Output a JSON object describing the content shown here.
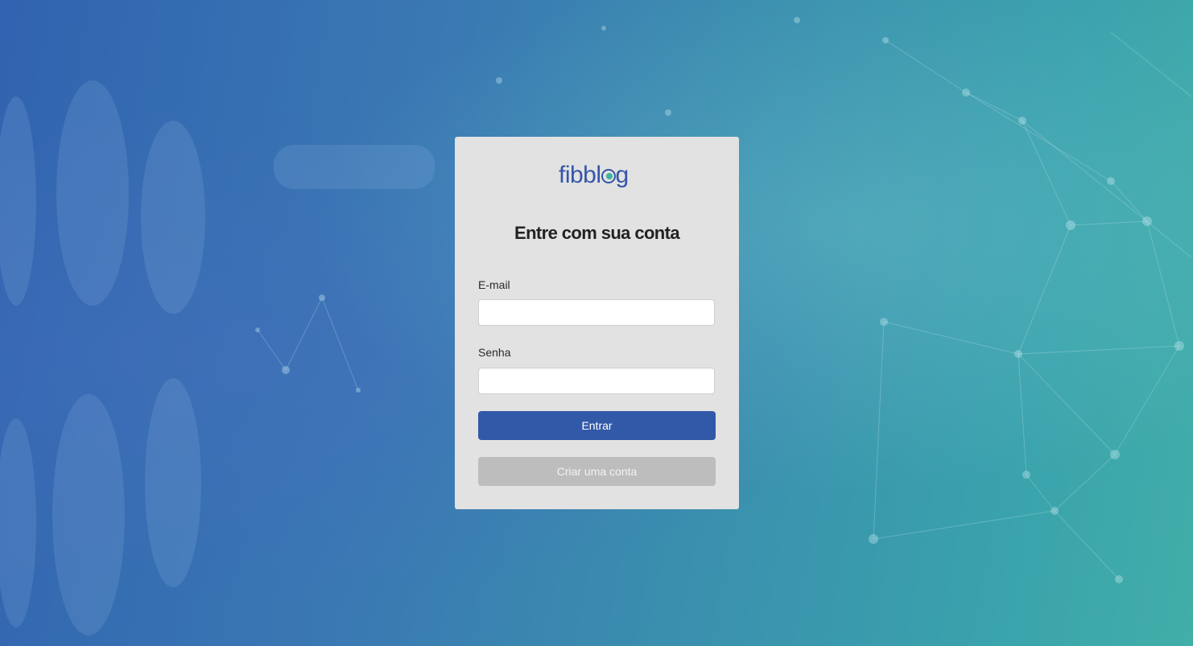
{
  "logo": {
    "text_before": "fibbl",
    "text_after": "g",
    "brand_color": "#3556a8",
    "accent_color": "#3db6a0"
  },
  "form": {
    "title": "Entre com sua conta",
    "email_label": "E-mail",
    "email_value": "",
    "password_label": "Senha",
    "password_value": "",
    "submit_label": "Entrar",
    "create_account_label": "Criar uma conta"
  },
  "colors": {
    "primary_button": "#3259a8",
    "secondary_button": "#bdbdbd",
    "card_background": "#e2e2e2"
  }
}
